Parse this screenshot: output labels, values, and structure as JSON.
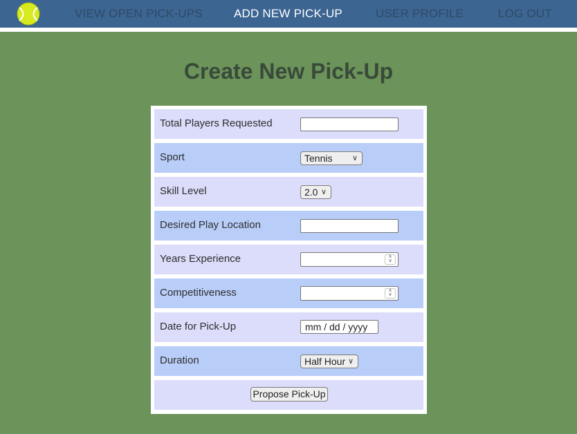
{
  "nav": {
    "logo_icon": "tennis-ball-icon",
    "links": [
      "VIEW OPEN PICK-UPS",
      "ADD NEW PICK-UP",
      "USER PROFILE",
      "LOG OUT"
    ],
    "active": "ADD NEW PICK-UP"
  },
  "page": {
    "title": "Create New Pick-Up"
  },
  "form": {
    "fields": [
      {
        "label": "Total Players Requested",
        "type": "text",
        "value": ""
      },
      {
        "label": "Sport",
        "type": "select",
        "value": "Tennis"
      },
      {
        "label": "Skill Level",
        "type": "select",
        "value": "2.0"
      },
      {
        "label": "Desired Play Location",
        "type": "text",
        "value": ""
      },
      {
        "label": "Years Experience",
        "type": "number",
        "value": ""
      },
      {
        "label": "Competitiveness",
        "type": "number",
        "value": ""
      },
      {
        "label": "Date for Pick-Up",
        "type": "date",
        "value": "mm / dd / yyyy"
      },
      {
        "label": "Duration",
        "type": "select",
        "value": "Half Hour"
      }
    ],
    "submit_label": "Propose Pick-Up"
  },
  "colors": {
    "background": "#6b935a",
    "navbar": "#3c6592",
    "row_light": "#dcdcfb",
    "row_dark": "#b8cdf8"
  }
}
